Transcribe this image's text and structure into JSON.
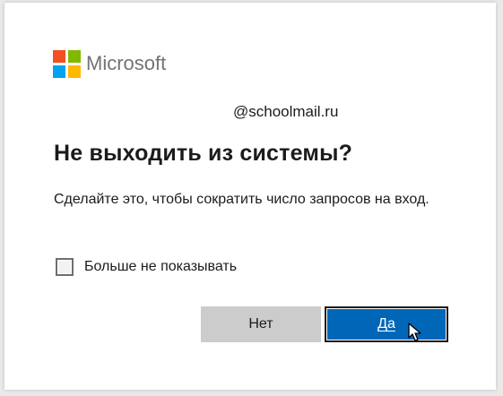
{
  "brand": {
    "name": "Microsoft",
    "logo_colors": [
      "#f25022",
      "#7fba00",
      "#00a4ef",
      "#ffb900"
    ]
  },
  "account": {
    "email": "@schoolmail.ru"
  },
  "dialog": {
    "title": "Не выходить из системы?",
    "description": "Сделайте это, чтобы сократить число запросов на вход."
  },
  "checkbox": {
    "label": "Больше не показывать",
    "checked": false
  },
  "buttons": {
    "no_label": "Нет",
    "yes_label": "Да"
  },
  "colors": {
    "primary": "#0067b8",
    "secondary": "#cccccc"
  },
  "cursor_icon": "mouse-pointer-icon"
}
